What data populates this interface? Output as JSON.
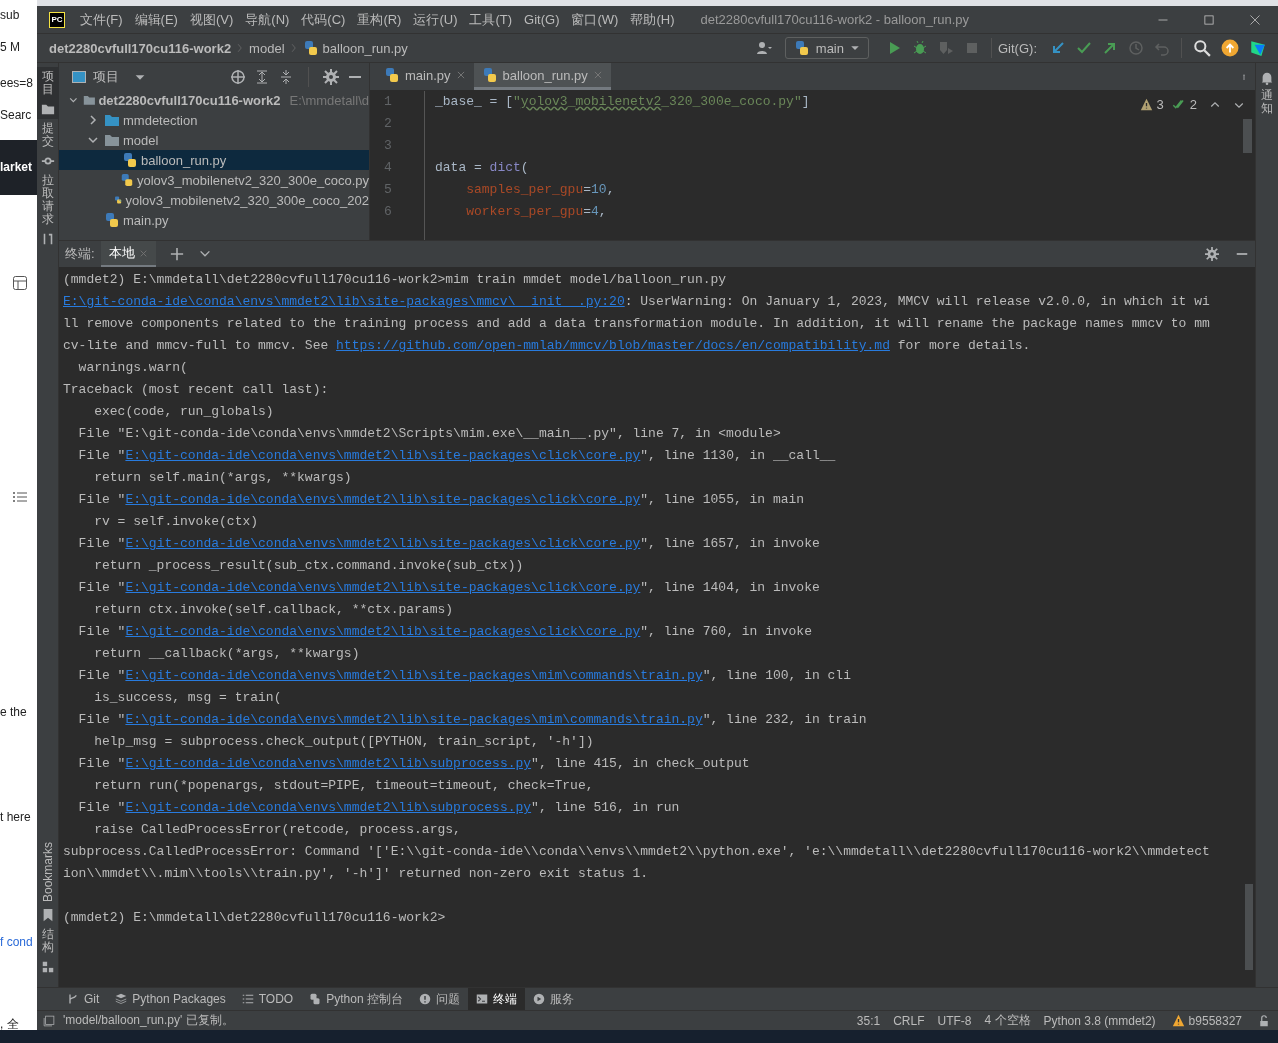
{
  "background_page": {
    "fragments": [
      {
        "text": "sub",
        "kind": "plain"
      },
      {
        "text": "5 M",
        "kind": "plain"
      },
      {
        "text": "ees=8",
        "kind": "plain"
      },
      {
        "text": "Searc",
        "kind": "plain"
      },
      {
        "text": "larket",
        "kind": "dark"
      },
      {
        "text": "e the",
        "kind": "plain"
      },
      {
        "text": "t here",
        "kind": "plain"
      },
      {
        "text": "f cond",
        "kind": "link"
      },
      {
        "text": ", 全",
        "kind": "plain"
      }
    ]
  },
  "window": {
    "logo": "PC",
    "title": "det2280cvfull170cu116-work2 - balloon_run.py",
    "menus": [
      "文件(F)",
      "编辑(E)",
      "视图(V)",
      "导航(N)",
      "代码(C)",
      "重构(R)",
      "运行(U)",
      "工具(T)",
      "Git(G)",
      "窗口(W)",
      "帮助(H)"
    ]
  },
  "navigation_bar": {
    "breadcrumbs": [
      "det2280cvfull170cu116-work2",
      "model",
      "balloon_run.py"
    ],
    "run_configuration": "main",
    "git_label": "Git(G):",
    "run_buttons": [
      {
        "kind": "run",
        "disabled": false
      },
      {
        "kind": "debug",
        "disabled": false
      },
      {
        "kind": "coverage",
        "disabled": true
      },
      {
        "kind": "stop",
        "disabled": true
      }
    ],
    "git_buttons": [
      {
        "kind": "update",
        "disabled": false
      },
      {
        "kind": "commit",
        "disabled": false
      },
      {
        "kind": "push",
        "disabled": false
      },
      {
        "kind": "history",
        "disabled": true
      },
      {
        "kind": "rollback",
        "disabled": true
      }
    ]
  },
  "left_tool_strip": {
    "top": [
      {
        "label": "项目",
        "kind": "project",
        "selected": true
      },
      {
        "label": "提交",
        "kind": "commit",
        "selected": false
      },
      {
        "label": "拉取请求",
        "kind": "pull_requests",
        "selected": false
      }
    ],
    "bottom": [
      {
        "label": "Bookmarks",
        "kind": "bookmarks",
        "selected": false
      },
      {
        "label": "结构",
        "kind": "structure",
        "selected": false
      }
    ]
  },
  "right_tool_strip": [
    {
      "label": "通知",
      "kind": "notifications"
    }
  ],
  "project_panel": {
    "title": "项目",
    "tree": [
      {
        "name": "det2280cvfull170cu116-work2",
        "kind": "folder",
        "path_hint": "E:\\mmdetall\\d",
        "expanded": true,
        "selected": false,
        "children": [
          {
            "name": "mmdetection",
            "kind": "source_folder",
            "expanded": false,
            "selected": false
          },
          {
            "name": "model",
            "kind": "folder",
            "expanded": true,
            "selected": false,
            "children": [
              {
                "name": "balloon_run.py",
                "kind": "python",
                "selected": true
              },
              {
                "name": "yolov3_mobilenetv2_320_300e_coco.py",
                "kind": "python",
                "selected": false
              },
              {
                "name": "yolov3_mobilenetv2_320_300e_coco_202",
                "kind": "unknown",
                "selected": false
              }
            ]
          },
          {
            "name": "main.py",
            "kind": "python",
            "selected": false
          }
        ]
      }
    ]
  },
  "editor": {
    "tabs": [
      {
        "label": "main.py",
        "selected": false
      },
      {
        "label": "balloon_run.py",
        "selected": true
      }
    ],
    "warnings": "3",
    "passed_checks": "2",
    "lines": [
      {
        "number": "1",
        "tokens": [
          {
            "kind": "plain",
            "text": "_base_ = ["
          },
          {
            "kind": "string",
            "text": "\""
          },
          {
            "kind": "string",
            "text": "yolov3",
            "typo": true
          },
          {
            "kind": "string",
            "text": "_"
          },
          {
            "kind": "string",
            "text": "mobilenetv2",
            "typo": true
          },
          {
            "kind": "string",
            "text": "_320_300e_coco.py\""
          },
          {
            "kind": "plain",
            "text": "]"
          }
        ]
      },
      {
        "number": "2"
      },
      {
        "number": "3"
      },
      {
        "number": "4",
        "tokens": [
          {
            "kind": "plain",
            "text": "data = "
          },
          {
            "kind": "builtin",
            "text": "dict"
          },
          {
            "kind": "plain",
            "text": "("
          }
        ]
      },
      {
        "number": "5",
        "tokens": [
          {
            "kind": "param",
            "text": "    samples_per_gpu"
          },
          {
            "kind": "plain",
            "text": "="
          },
          {
            "kind": "number",
            "text": "10"
          },
          {
            "kind": "plain",
            "text": ","
          }
        ]
      },
      {
        "number": "6",
        "tokens": [
          {
            "kind": "param",
            "text": "    workers_per_gpu"
          },
          {
            "kind": "plain",
            "text": "="
          },
          {
            "kind": "number",
            "text": "4"
          },
          {
            "kind": "plain",
            "text": ","
          }
        ]
      }
    ]
  },
  "terminal": {
    "label": "终端:",
    "tabs": [
      {
        "label": "本地",
        "selected": true
      }
    ],
    "lines": [
      {
        "kind": "output",
        "segments": [
          {
            "kind": "text",
            "text": "(mmdet2) E:\\mmdetall\\det2280cvfull170cu116-work2>mim train mmdet model/balloon_run.py"
          }
        ]
      },
      {
        "kind": "output",
        "segments": [
          {
            "kind": "link",
            "text": "E:\\git-conda-ide\\conda\\envs\\mmdet2\\lib\\site-packages\\mmcv\\__init__.py:20"
          },
          {
            "kind": "text",
            "text": ": UserWarning: On January 1, 2023, MMCV will release v2.0.0, in which it wi"
          }
        ]
      },
      {
        "kind": "output",
        "segments": [
          {
            "kind": "text",
            "text": "ll remove components related to the training process and add a data transformation module. In addition, it will rename the package names mmcv to mm"
          }
        ]
      },
      {
        "kind": "output",
        "segments": [
          {
            "kind": "text",
            "text": "cv-lite and mmcv-full to mmcv. See "
          },
          {
            "kind": "link",
            "text": "https://github.com/open-mmlab/mmcv/blob/master/docs/en/compatibility.md"
          },
          {
            "kind": "text",
            "text": " for more details."
          }
        ]
      },
      {
        "kind": "output",
        "segments": [
          {
            "kind": "text",
            "text": "  warnings.warn("
          }
        ]
      },
      {
        "kind": "output",
        "segments": [
          {
            "kind": "text",
            "text": "Traceback (most recent call last):"
          }
        ]
      },
      {
        "kind": "output",
        "segments": [
          {
            "kind": "text",
            "text": "    exec(code, run_globals)"
          }
        ]
      },
      {
        "kind": "output",
        "segments": [
          {
            "kind": "text",
            "text": "  File \"E:\\git-conda-ide\\conda\\envs\\mmdet2\\Scripts\\mim.exe\\__main__.py\", line 7, in <module>"
          }
        ]
      },
      {
        "kind": "output",
        "segments": [
          {
            "kind": "text",
            "text": "  File \""
          },
          {
            "kind": "link",
            "text": "E:\\git-conda-ide\\conda\\envs\\mmdet2\\lib\\site-packages\\click\\core.py"
          },
          {
            "kind": "text",
            "text": "\", line 1130, in __call__"
          }
        ]
      },
      {
        "kind": "output",
        "segments": [
          {
            "kind": "text",
            "text": "    return self.main(*args, **kwargs)"
          }
        ]
      },
      {
        "kind": "output",
        "segments": [
          {
            "kind": "text",
            "text": "  File \""
          },
          {
            "kind": "link",
            "text": "E:\\git-conda-ide\\conda\\envs\\mmdet2\\lib\\site-packages\\click\\core.py"
          },
          {
            "kind": "text",
            "text": "\", line 1055, in main"
          }
        ]
      },
      {
        "kind": "output",
        "segments": [
          {
            "kind": "text",
            "text": "    rv = self.invoke(ctx)"
          }
        ]
      },
      {
        "kind": "output",
        "segments": [
          {
            "kind": "text",
            "text": "  File \""
          },
          {
            "kind": "link",
            "text": "E:\\git-conda-ide\\conda\\envs\\mmdet2\\lib\\site-packages\\click\\core.py"
          },
          {
            "kind": "text",
            "text": "\", line 1657, in invoke"
          }
        ]
      },
      {
        "kind": "output",
        "segments": [
          {
            "kind": "text",
            "text": "    return _process_result(sub_ctx.command.invoke(sub_ctx))"
          }
        ]
      },
      {
        "kind": "output",
        "segments": [
          {
            "kind": "text",
            "text": "  File \""
          },
          {
            "kind": "link",
            "text": "E:\\git-conda-ide\\conda\\envs\\mmdet2\\lib\\site-packages\\click\\core.py"
          },
          {
            "kind": "text",
            "text": "\", line 1404, in invoke"
          }
        ]
      },
      {
        "kind": "output",
        "segments": [
          {
            "kind": "text",
            "text": "    return ctx.invoke(self.callback, **ctx.params)"
          }
        ]
      },
      {
        "kind": "output",
        "segments": [
          {
            "kind": "text",
            "text": "  File \""
          },
          {
            "kind": "link",
            "text": "E:\\git-conda-ide\\conda\\envs\\mmdet2\\lib\\site-packages\\click\\core.py"
          },
          {
            "kind": "text",
            "text": "\", line 760, in invoke"
          }
        ]
      },
      {
        "kind": "output",
        "segments": [
          {
            "kind": "text",
            "text": "    return __callback(*args, **kwargs)"
          }
        ]
      },
      {
        "kind": "output",
        "segments": [
          {
            "kind": "text",
            "text": "  File \""
          },
          {
            "kind": "link",
            "text": "E:\\git-conda-ide\\conda\\envs\\mmdet2\\lib\\site-packages\\mim\\commands\\train.py"
          },
          {
            "kind": "text",
            "text": "\", line 100, in cli"
          }
        ]
      },
      {
        "kind": "output",
        "segments": [
          {
            "kind": "text",
            "text": "    is_success, msg = train("
          }
        ]
      },
      {
        "kind": "output",
        "segments": [
          {
            "kind": "text",
            "text": "  File \""
          },
          {
            "kind": "link",
            "text": "E:\\git-conda-ide\\conda\\envs\\mmdet2\\lib\\site-packages\\mim\\commands\\train.py"
          },
          {
            "kind": "text",
            "text": "\", line 232, in train"
          }
        ]
      },
      {
        "kind": "output",
        "segments": [
          {
            "kind": "text",
            "text": "    help_msg = subprocess.check_output([PYTHON, train_script, '-h'])"
          }
        ]
      },
      {
        "kind": "output",
        "segments": [
          {
            "kind": "text",
            "text": "  File \""
          },
          {
            "kind": "link",
            "text": "E:\\git-conda-ide\\conda\\envs\\mmdet2\\lib\\subprocess.py"
          },
          {
            "kind": "text",
            "text": "\", line 415, in check_output"
          }
        ]
      },
      {
        "kind": "output",
        "segments": [
          {
            "kind": "text",
            "text": "    return run(*popenargs, stdout=PIPE, timeout=timeout, check=True,"
          }
        ]
      },
      {
        "kind": "output",
        "segments": [
          {
            "kind": "text",
            "text": "  File \""
          },
          {
            "kind": "link",
            "text": "E:\\git-conda-ide\\conda\\envs\\mmdet2\\lib\\subprocess.py"
          },
          {
            "kind": "text",
            "text": "\", line 516, in run"
          }
        ]
      },
      {
        "kind": "output",
        "segments": [
          {
            "kind": "text",
            "text": "    raise CalledProcessError(retcode, process.args,"
          }
        ]
      },
      {
        "kind": "output",
        "segments": [
          {
            "kind": "text",
            "text": "subprocess.CalledProcessError: Command '['E:\\\\git-conda-ide\\\\conda\\\\envs\\\\mmdet2\\\\python.exe', 'e:\\\\mmdetall\\\\det2280cvfull170cu116-work2\\\\mmdetect"
          }
        ]
      },
      {
        "kind": "output",
        "segments": [
          {
            "kind": "text",
            "text": "ion\\\\mmdet\\\\.mim\\\\tools\\\\train.py', '-h']' returned non-zero exit status 1."
          }
        ]
      },
      {
        "kind": "blank"
      },
      {
        "kind": "output",
        "segments": [
          {
            "kind": "text",
            "text": "(mmdet2) E:\\mmdetall\\det2280cvfull170cu116-work2>"
          }
        ]
      }
    ]
  },
  "tool_windows": [
    {
      "label": "Git",
      "kind": "git",
      "selected": false
    },
    {
      "label": "Python Packages",
      "kind": "packages",
      "selected": false
    },
    {
      "label": "TODO",
      "kind": "todo",
      "selected": false
    },
    {
      "label": "Python 控制台",
      "kind": "console",
      "selected": false
    },
    {
      "label": "问题",
      "kind": "problems",
      "selected": false
    },
    {
      "label": "终端",
      "kind": "terminal",
      "selected": true
    },
    {
      "label": "服务",
      "kind": "services",
      "selected": false
    }
  ],
  "status_bar": {
    "message": "'model/balloon_run.py' 已复制。",
    "items": [
      "35:1",
      "CRLF",
      "UTF-8",
      "4 个空格",
      "Python 3.8 (mmdet2)"
    ],
    "revision": "b9558327"
  }
}
